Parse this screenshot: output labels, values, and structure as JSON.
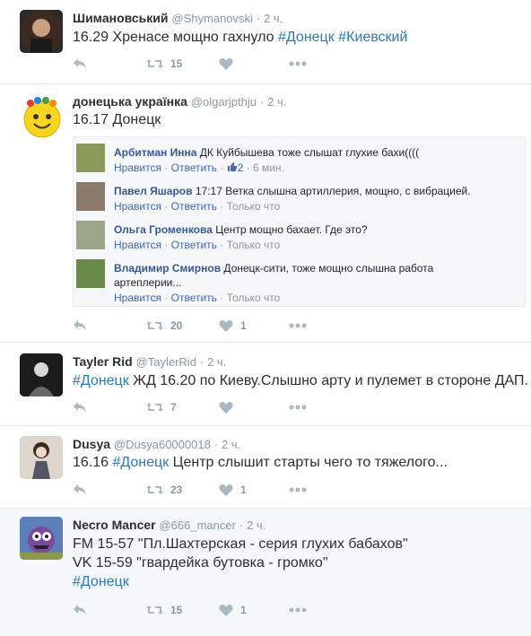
{
  "tweets": [
    {
      "name": "Шимановський",
      "handle": "@Shymanovski",
      "dot": "·",
      "time": "2 ч.",
      "text_parts": [
        {
          "t": "16.29 Хренасе мощно гахнуло ",
          "tag": false
        },
        {
          "t": "#Донецк",
          "tag": true
        },
        {
          "t": " ",
          "tag": false
        },
        {
          "t": "#Киевский",
          "tag": true
        }
      ],
      "retweets": "15",
      "likes": ""
    },
    {
      "name": "донецька українка",
      "handle": "@olgarjpthju",
      "dot": "·",
      "time": "2 ч.",
      "text_parts": [
        {
          "t": "16.17 Донецк",
          "tag": false
        }
      ],
      "retweets": "20",
      "likes": "1",
      "fb_comments": [
        {
          "author": "Арбитман Инна",
          "text": " ДК Куйбышева тоже слышат глухие бахи((((",
          "line2": "",
          "like": "Нравится",
          "reply": "Ответить",
          "reactions": "2",
          "time": "6 мин."
        },
        {
          "author": "Павел Яшаров",
          "text": " 17:17 Ветка слышна артиллерия, мощно, с вибрацией.",
          "line2": "",
          "like": "Нравится",
          "reply": "Ответить",
          "reactions": "",
          "time": "Только что"
        },
        {
          "author": "Ольга Громенкова",
          "text": " Центр мощно бахает. Где это?",
          "line2": "",
          "like": "Нравится",
          "reply": "Ответить",
          "reactions": "",
          "time": "Только что"
        },
        {
          "author": "Владимир Смирнов",
          "text": " Донецк-сити, тоже мощно слышна работа",
          "line2": "артеплерии...",
          "like": "Нравится",
          "reply": "Ответить",
          "reactions": "",
          "time": "Только что"
        }
      ]
    },
    {
      "name": "Tayler Rid",
      "handle": "@TaylerRid",
      "dot": "·",
      "time": "2 ч.",
      "text_parts": [
        {
          "t": "#Донецк",
          "tag": true
        },
        {
          "t": " ЖД 16.20 по Киеву.Слышно арту и пулемет в стороне ДАП.",
          "tag": false
        }
      ],
      "retweets": "7",
      "likes": ""
    },
    {
      "name": "Dusya",
      "handle": "@Dusya60000018",
      "dot": "·",
      "time": "2 ч.",
      "text_parts": [
        {
          "t": "16.16 ",
          "tag": false
        },
        {
          "t": "#Донецк",
          "tag": true
        },
        {
          "t": " Центр слышит старты чего то тяжелого...",
          "tag": false
        }
      ],
      "retweets": "23",
      "likes": "1"
    },
    {
      "name": "Necro Mancer",
      "handle": "@666_mancer",
      "dot": "·",
      "time": "2 ч.",
      "lines": [
        [
          {
            "t": "FM 15-57 \"Пл.Шахтерская - серия глухих бабахов\"",
            "tag": false
          }
        ],
        [
          {
            "t": "VK 15-59 \"гвардейка бутовка - громко\"",
            "tag": false
          }
        ],
        [
          {
            "t": "#Донецк",
            "tag": true
          }
        ]
      ],
      "retweets": "15",
      "likes": "1"
    }
  ],
  "icons": {
    "reply": "reply-icon",
    "retweet": "retweet-icon",
    "like": "heart-icon",
    "more": "more-icon",
    "fb_like": "thumbs-up-icon"
  },
  "colors": {
    "hashtag": "#2b7bb9",
    "meta": "#8899a6",
    "icon": "#aab8c2",
    "fb_name": "#365899",
    "fb_link": "#4267b2"
  }
}
